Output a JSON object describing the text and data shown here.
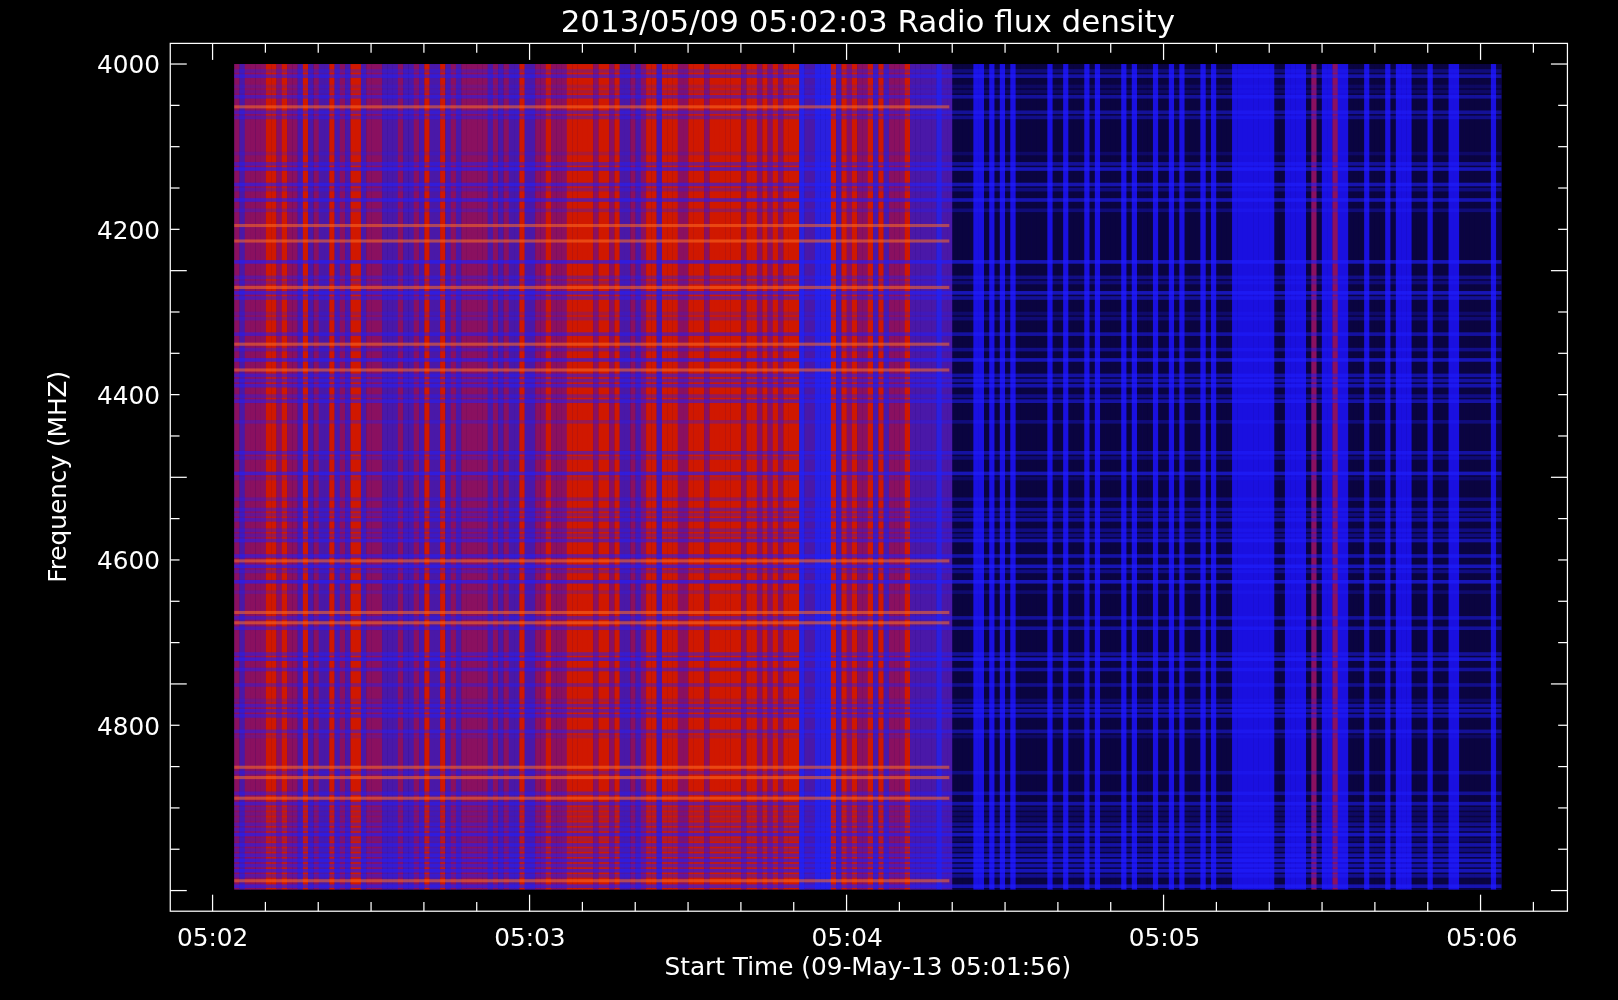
{
  "title": "2013/05/09 05:02:03 Radio flux density",
  "y_axis": {
    "label": "Frequency (MHZ)",
    "ticks": [
      "4000",
      "4200",
      "4400",
      "4600",
      "4800"
    ]
  },
  "x_axis": {
    "label": "Start Time (09-May-13 05:01:56)",
    "ticks": [
      "05:02",
      "05:03",
      "05:04",
      "05:05",
      "05:06"
    ]
  }
}
